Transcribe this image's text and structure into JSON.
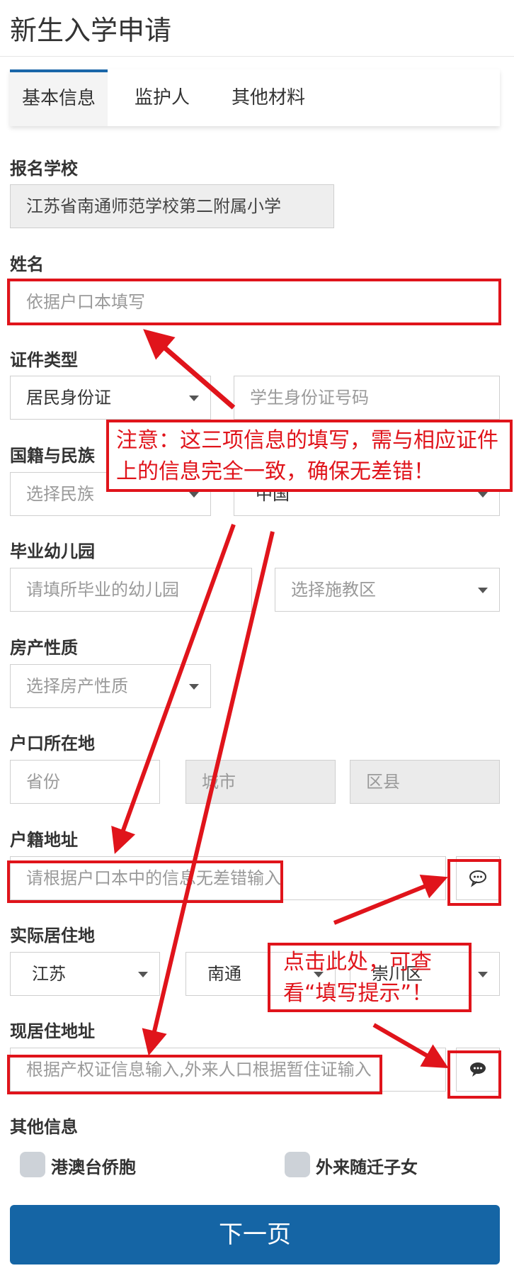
{
  "header": {
    "title": "新生入学申请"
  },
  "tabs": [
    {
      "label": "基本信息",
      "active": true
    },
    {
      "label": "监护人",
      "active": false
    },
    {
      "label": "其他材料",
      "active": false
    }
  ],
  "form": {
    "school": {
      "label": "报名学校",
      "value": "江苏省南通师范学校第二附属小学"
    },
    "name": {
      "label": "姓名",
      "placeholder": "依据户口本填写"
    },
    "id_type": {
      "label": "证件类型",
      "value": "居民身份证",
      "id_placeholder": "学生身份证号码"
    },
    "nationality": {
      "label": "国籍与民族",
      "ethnicity_placeholder": "选择民族",
      "country_value": "中国"
    },
    "kindergarten": {
      "label": "毕业幼儿园",
      "placeholder": "请填所毕业的幼儿园",
      "district_placeholder": "选择施教区"
    },
    "property": {
      "label": "房产性质",
      "placeholder": "选择房产性质"
    },
    "hukou_location": {
      "label": "户口所在地",
      "province": "省份",
      "city": "城市",
      "county": "区县"
    },
    "hukou_address": {
      "label": "户籍地址",
      "placeholder": "请根据户口本中的信息无差错输入"
    },
    "residence": {
      "label": "实际居住地",
      "province": "江苏",
      "city": "南通",
      "district": "崇川区"
    },
    "current_address": {
      "label": "现居住地址",
      "placeholder": "根据产权证信息输入,外来人口根据暂住证输入"
    },
    "other": {
      "label": "其他信息",
      "option1": "港澳台侨胞",
      "option2": "外来随迁子女"
    }
  },
  "next_button": "下一页",
  "annotations": {
    "note1": "注意：这三项信息的填写，需与相应证件上的信息完全一致，确保无差错！",
    "note2": "点击此处，可查看“填写提示”！"
  },
  "colors": {
    "accent": "#1565a5",
    "annotation": "#e0141b"
  }
}
